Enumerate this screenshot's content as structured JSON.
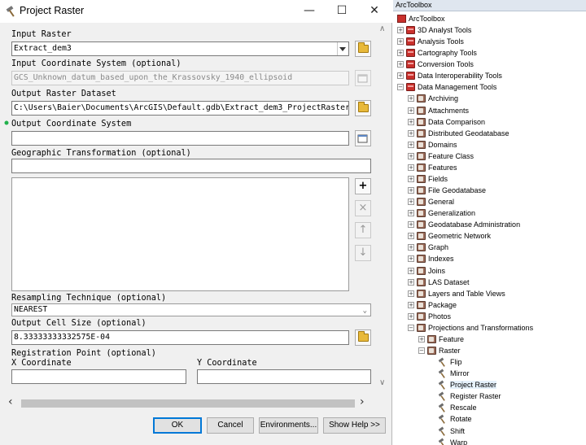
{
  "dialog": {
    "title": "Project Raster",
    "buttons": {
      "ok": "OK",
      "cancel": "Cancel",
      "environments": "Environments...",
      "show_help": "Show Help >>"
    }
  },
  "form": {
    "input_raster": {
      "label": "Input Raster",
      "value": "Extract_dem3"
    },
    "input_coord_system": {
      "label": "Input Coordinate System (optional)",
      "value": "GCS_Unknown_datum_based_upon_the_Krassovsky_1940_ellipsoid"
    },
    "output_raster": {
      "label": "Output Raster Dataset",
      "value": "C:\\Users\\Baier\\Documents\\ArcGIS\\Default.gdb\\Extract_dem3_ProjectRaster"
    },
    "output_coord_system": {
      "label": "Output Coordinate System",
      "value": ""
    },
    "geo_transformation": {
      "label": "Geographic Transformation (optional)",
      "value": ""
    },
    "resampling": {
      "label": "Resampling Technique (optional)",
      "value": "NEAREST"
    },
    "cell_size": {
      "label": "Output Cell Size (optional)",
      "value": "8.33333333332575E-04"
    },
    "registration_point": {
      "label": "Registration Point (optional)",
      "x_label": "X Coordinate",
      "y_label": "Y Coordinate",
      "x_value": "",
      "y_value": ""
    }
  },
  "list_buttons": {
    "add": "+",
    "remove": "×",
    "up": "↑",
    "down": "↓"
  },
  "toolbox": {
    "header": "ArcToolbox",
    "root": "ArcToolbox",
    "toolboxes": [
      "3D Analyst Tools",
      "Analysis Tools",
      "Cartography Tools",
      "Conversion Tools",
      "Data Interoperability Tools",
      "Data Management Tools"
    ],
    "dm_toolsets": [
      "Archiving",
      "Attachments",
      "Data Comparison",
      "Distributed Geodatabase",
      "Domains",
      "Feature Class",
      "Features",
      "Fields",
      "File Geodatabase",
      "General",
      "Generalization",
      "Geodatabase Administration",
      "Geometric Network",
      "Graph",
      "Indexes",
      "Joins",
      "LAS Dataset",
      "Layers and Table Views",
      "Package",
      "Photos",
      "Projections and Transformations"
    ],
    "pt_toolsets": [
      "Feature",
      "Raster"
    ],
    "raster_tools": [
      "Flip",
      "Mirror",
      "Project Raster",
      "Register Raster",
      "Rescale",
      "Rotate",
      "Shift",
      "Warp"
    ],
    "selected_tool": "Project Raster"
  }
}
